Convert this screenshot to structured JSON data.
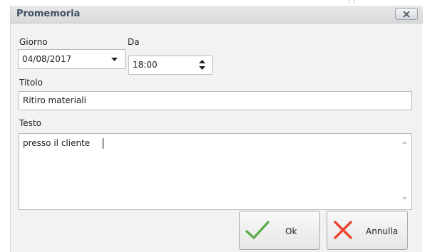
{
  "dialog": {
    "title": "Promemoria",
    "close_icon": "close-icon"
  },
  "form": {
    "day": {
      "label": "Giorno",
      "value": "04/08/2017",
      "icon": "dropdown-arrow-icon"
    },
    "time": {
      "label": "Da",
      "value": "18:00",
      "icon": "spinner-arrows-icon"
    },
    "title": {
      "label": "Titolo",
      "value": "Ritiro materiali"
    },
    "text": {
      "label": "Testo",
      "value": "presso il cliente"
    }
  },
  "buttons": {
    "ok": {
      "label": "Ok",
      "icon": "checkmark-icon"
    },
    "cancel": {
      "label": "Annulla",
      "icon": "x-icon"
    }
  },
  "colors": {
    "title_text": "#3f4f65",
    "ok_check": "#5aaa46",
    "cancel_x": "#e8442e"
  }
}
